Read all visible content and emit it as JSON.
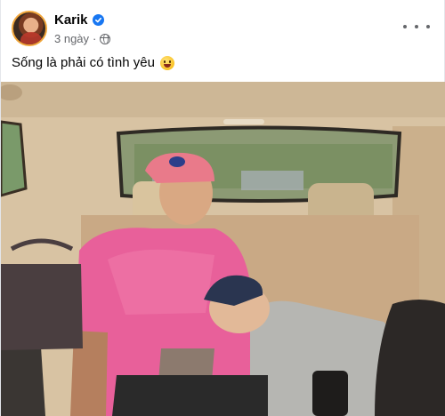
{
  "post": {
    "author": "Karik",
    "timestamp": "3 ngày",
    "visibility_icon": "globe-icon",
    "verified_icon": "verified-badge-icon",
    "more_icon": "more-options-icon",
    "caption": "Sống là phải có tình yêu",
    "caption_emoji": "grinning-face-emoji",
    "photo": "photo-in-car-backseat"
  },
  "colors": {
    "verified": "#1877f2",
    "secondary_text": "#65676b"
  }
}
